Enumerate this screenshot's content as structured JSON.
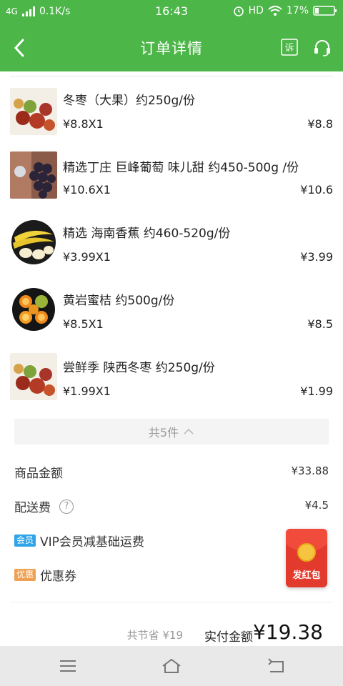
{
  "status_bar": {
    "network": "4G",
    "speed": "0.1K/s",
    "time": "16:43",
    "hd": "HD",
    "battery": "17%"
  },
  "header": {
    "title": "订单详情",
    "icons": [
      "back-arrow-icon",
      "complaint-icon",
      "customer-service-icon"
    ],
    "complaint_glyph": "诉"
  },
  "products": [
    {
      "name": "冬枣（大果）约250g/份",
      "qty": "¥8.8X1",
      "price": "¥8.8",
      "image": "winter-jujube"
    },
    {
      "name": "精选丁庄 巨峰葡萄 味儿甜 约450-500g /份",
      "qty": "¥10.6X1",
      "price": "¥10.6",
      "image": "grapes"
    },
    {
      "name": "精选 海南香蕉  约460-520g/份",
      "qty": "¥3.99X1",
      "price": "¥3.99",
      "image": "banana"
    },
    {
      "name": "黄岩蜜桔  约500g/份",
      "qty": "¥8.5X1",
      "price": "¥8.5",
      "image": "tangerine"
    },
    {
      "name": "尝鲜季 陕西冬枣  约250g/份",
      "qty": "¥1.99X1",
      "price": "¥1.99",
      "image": "winter-jujube"
    }
  ],
  "collapse": {
    "label": "共5件"
  },
  "fees": {
    "goods_label": "商品金额",
    "goods_value": "¥33.88",
    "delivery_label": "配送费",
    "delivery_value": "¥4.5",
    "help_glyph": "?",
    "vip_tag": "会员",
    "vip_label": "VIP会员减基础运费",
    "coupon_tag": "优惠",
    "coupon_label": "优惠券"
  },
  "summary": {
    "saved_label": "共节省",
    "saved_value": "¥19",
    "pay_label": "实付金额",
    "pay_value": "¥19.38"
  },
  "red_packet": {
    "label": "发红包"
  },
  "colors": {
    "brand_green": "#4cb648",
    "vip_tag": "#2fa4e7",
    "coupon_tag": "#f0a050"
  }
}
